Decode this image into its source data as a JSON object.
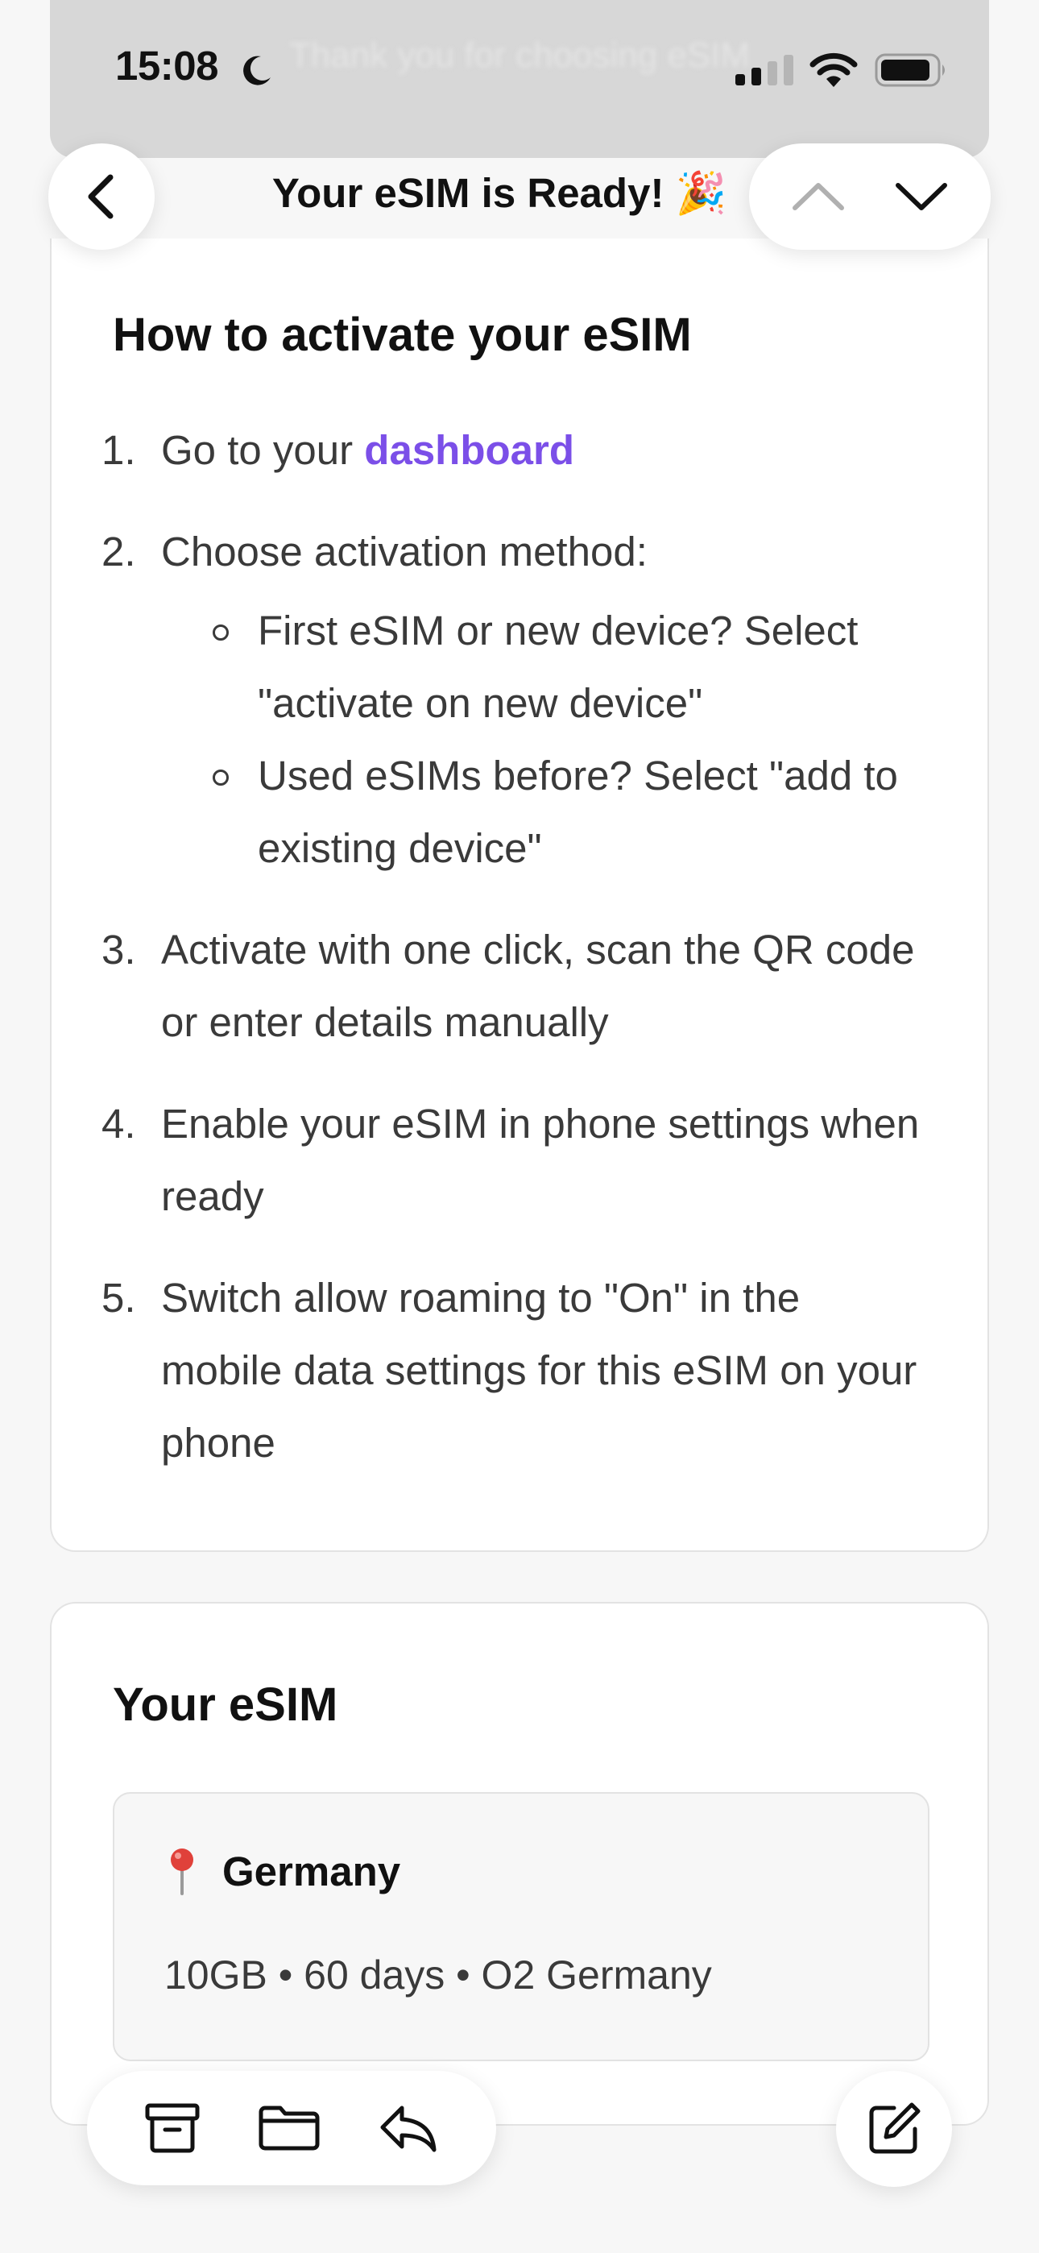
{
  "status_bar": {
    "time": "15:08",
    "ghost_text": "Thank you for choosing eSIM"
  },
  "nav": {
    "title": "Your eSIM is Ready! 🎉"
  },
  "activation": {
    "title": "How to activate your eSIM",
    "steps": [
      {
        "num": "1.",
        "text": "Go to your ",
        "link": "dashboard"
      },
      {
        "num": "2.",
        "text": "Choose activation method:",
        "sub": [
          "First eSIM or new device? Select \"activate on new device\"",
          "Used eSIMs before? Select \"add to existing device\""
        ]
      },
      {
        "num": "3.",
        "text": "Activate with one click, scan the QR code or enter details manually"
      },
      {
        "num": "4.",
        "text": "Enable your eSIM in phone settings when ready"
      },
      {
        "num": "5.",
        "text": "Switch allow roaming to \"On\" in the mobile data settings for this eSIM on your phone"
      }
    ]
  },
  "esim": {
    "title": "Your eSIM",
    "country": "Germany",
    "details": "10GB • 60 days • O2 Germany"
  },
  "colors": {
    "link": "#7b4fe8",
    "pin": "#e0413a"
  },
  "icons": {
    "back": "chevron-left-icon",
    "up": "chevron-up-icon",
    "down": "chevron-down-icon",
    "archive": "archive-icon",
    "folder": "folder-icon",
    "reply": "reply-icon",
    "compose": "compose-icon"
  }
}
